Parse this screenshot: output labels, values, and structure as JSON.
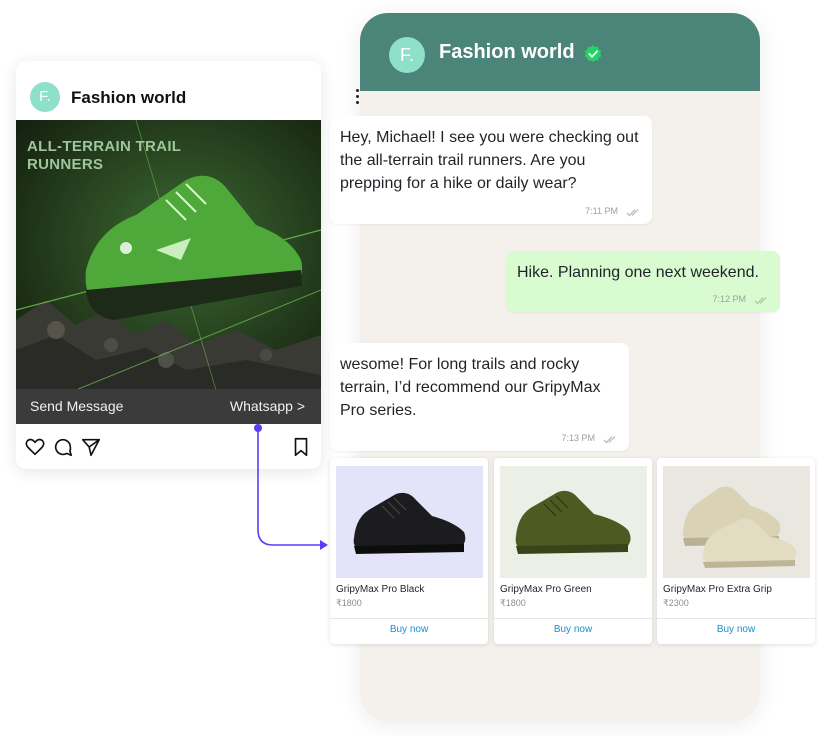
{
  "brand": {
    "name": "Fashion world",
    "avatar_letter": "F.",
    "header_color": "#4b8479",
    "avatar_color": "#8fe0c8",
    "verified_color": "#25d366"
  },
  "chat": {
    "messages": [
      {
        "direction": "incoming",
        "text": "Hey, Michael! I see you were checking out the all-terrain trail runners. Are you prepping for a hike or daily wear?",
        "time": "7:11 PM"
      },
      {
        "direction": "outgoing",
        "text": "Hike. Planning one next weekend.",
        "time": "7:12 PM"
      },
      {
        "direction": "incoming",
        "text": "wesome! For long trails and rocky terrain, I’d recommend our GripyMax Pro series.",
        "time": "7:13 PM"
      }
    ],
    "outgoing_bubble_color": "#d9fbd0"
  },
  "products": [
    {
      "name": "GripyMax Pro Black",
      "price": "₹1800",
      "cta": "Buy now",
      "bg": "#e3e3fa",
      "shoe_color": "#1c1c1e"
    },
    {
      "name": "GripyMax Pro Green",
      "price": "₹1800",
      "cta": "Buy now",
      "bg": "#ecefe6",
      "shoe_color": "#4f5a22"
    },
    {
      "name": "GripyMax Pro Extra Grip",
      "price": "₹2300",
      "cta": "Buy now",
      "bg": "#e9e7df",
      "shoe_color": "#d9d2b4"
    }
  ],
  "post": {
    "ad_headline": "ALL-TERRAIN TRAIL RUNNERS",
    "cta_left": "Send Message",
    "cta_right": "Whatsapp >",
    "actions": [
      "heart-icon",
      "comment-icon",
      "share-icon",
      "bookmark-icon"
    ]
  },
  "connector_color": "#5b3df5"
}
